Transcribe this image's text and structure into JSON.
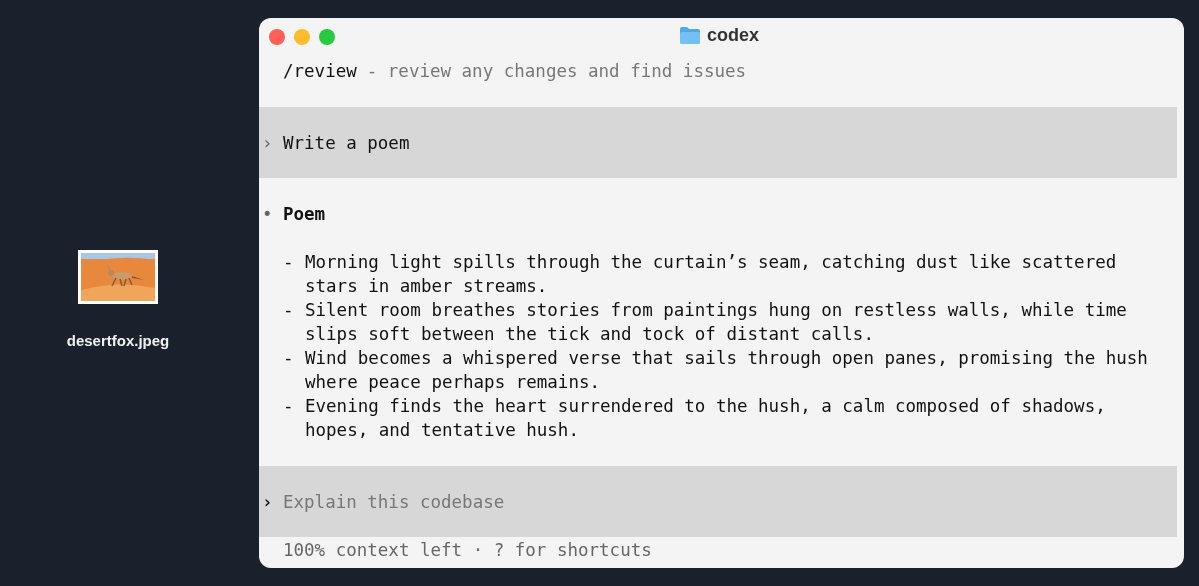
{
  "desktop_icon": {
    "kind": "picture",
    "label": "desertfox.jpeg"
  },
  "window": {
    "title": "codex"
  },
  "command": {
    "name": "/review",
    "description": "- review any changes and find issues"
  },
  "messages": [
    {
      "kind": "user",
      "marker": "›",
      "text": "Write a poem"
    },
    {
      "kind": "assistant",
      "marker": "•",
      "heading": "Poem",
      "bullets": [
        {
          "marker": "-",
          "lines": [
            "Morning light spills through the curtain’s seam, catching dust like scattered",
            "stars in amber streams."
          ]
        },
        {
          "marker": "-",
          "lines": [
            "Silent room breathes stories from paintings hung on restless walls, while time",
            "slips soft between the tick and tock of distant calls."
          ]
        },
        {
          "marker": "-",
          "lines": [
            "Wind becomes a whispered verse that sails through open panes, promising the hush",
            "where peace perhaps remains."
          ]
        },
        {
          "marker": "-",
          "lines": [
            "Evening finds the heart surrendered to the hush, a calm composed of shadows,",
            "hopes, and tentative hush."
          ]
        }
      ]
    }
  ],
  "input": {
    "prompt": "›",
    "placeholder": "Explain this codebase"
  },
  "status": "100% context left · ? for shortcuts"
}
